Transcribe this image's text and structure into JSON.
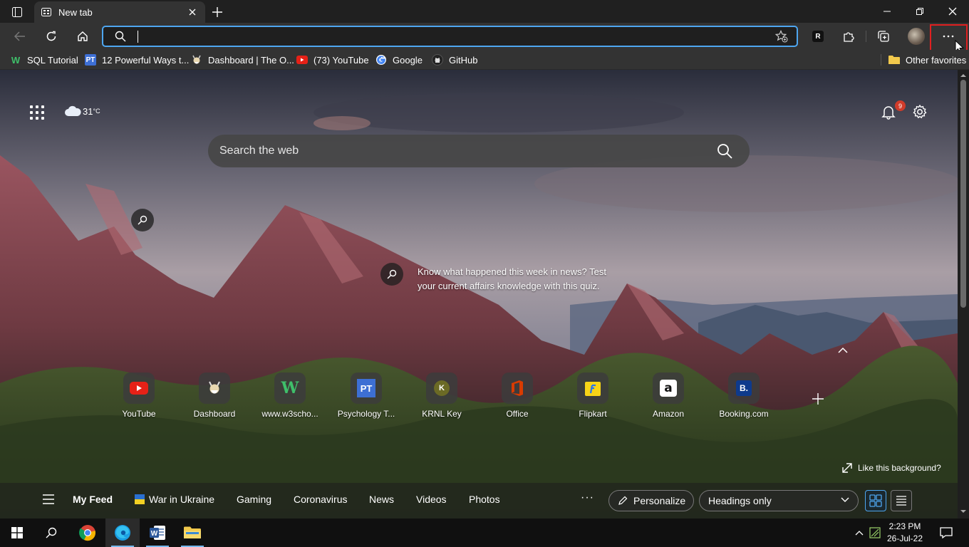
{
  "browser": {
    "tab": {
      "title": "New tab"
    },
    "address_bar": {
      "value": "",
      "placeholder": ""
    },
    "favorites": [
      {
        "label": "SQL Tutorial",
        "icon": "w3schools-icon"
      },
      {
        "label": "12 Powerful Ways t...",
        "icon": "pt-icon"
      },
      {
        "label": "Dashboard | The O...",
        "icon": "odin-icon"
      },
      {
        "label": "(73) YouTube",
        "icon": "youtube-icon"
      },
      {
        "label": "Google",
        "icon": "google-icon"
      },
      {
        "label": "GitHub",
        "icon": "github-icon"
      }
    ],
    "other_favorites": "Other favorites",
    "accent_color": "#4ea6f0",
    "highlight_color": "#e02020"
  },
  "newtab": {
    "weather": {
      "temp": "31",
      "unit": "°C"
    },
    "notifications_count": "9",
    "search": {
      "placeholder": "Search the web"
    },
    "hotspot_text": "Know what happened this week in news? Test your current affairs knowledge with this quiz.",
    "quick_links": [
      {
        "label": "YouTube",
        "icon": "youtube-icon"
      },
      {
        "label": "Dashboard",
        "icon": "odin-icon"
      },
      {
        "label": "www.w3scho...",
        "icon": "w3schools-icon"
      },
      {
        "label": "Psychology T...",
        "icon": "pt-icon"
      },
      {
        "label": "KRNL Key",
        "icon": "krnl-icon"
      },
      {
        "label": "Office",
        "icon": "office-icon"
      },
      {
        "label": "Flipkart",
        "icon": "flipkart-icon"
      },
      {
        "label": "Amazon",
        "icon": "amazon-icon"
      },
      {
        "label": "Booking.com",
        "icon": "booking-icon"
      }
    ],
    "like_background": "Like this background?",
    "feed": {
      "items": [
        "My Feed",
        "War in Ukraine",
        "Gaming",
        "Coronavirus",
        "News",
        "Videos",
        "Photos"
      ],
      "more": "···",
      "personalize": "Personalize",
      "headings_select": "Headings only"
    }
  },
  "taskbar": {
    "time": "2:23 PM",
    "date": "26-Jul-22"
  }
}
